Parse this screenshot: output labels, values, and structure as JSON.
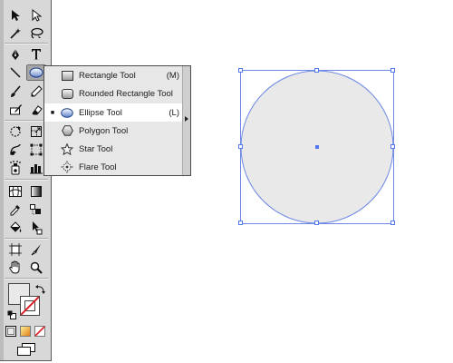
{
  "toolbar": {
    "tools": [
      {
        "name": "selection-tool",
        "icon": "black-arrow-icon"
      },
      {
        "name": "direct-selection-tool",
        "icon": "white-arrow-icon"
      },
      {
        "name": "magic-wand-tool",
        "icon": "magic-wand-icon"
      },
      {
        "name": "lasso-tool",
        "icon": "lasso-icon"
      },
      {
        "name": "pen-tool",
        "icon": "pen-icon"
      },
      {
        "name": "type-tool",
        "icon": "type-icon"
      },
      {
        "name": "line-segment-tool",
        "icon": "line-icon"
      },
      {
        "name": "ellipse-tool",
        "icon": "ellipse-icon",
        "active": true
      },
      {
        "name": "paintbrush-tool",
        "icon": "brush-icon"
      },
      {
        "name": "pencil-tool",
        "icon": "pencil-icon"
      },
      {
        "name": "blob-brush-tool",
        "icon": "blob-brush-icon"
      },
      {
        "name": "eraser-tool",
        "icon": "eraser-icon"
      },
      {
        "name": "rotate-tool",
        "icon": "rotate-icon"
      },
      {
        "name": "scale-tool",
        "icon": "scale-icon"
      },
      {
        "name": "warp-tool",
        "icon": "warp-icon"
      },
      {
        "name": "free-transform-tool",
        "icon": "free-transform-icon"
      },
      {
        "name": "symbol-sprayer-tool",
        "icon": "symbol-sprayer-icon"
      },
      {
        "name": "column-graph-tool",
        "icon": "column-graph-icon"
      },
      {
        "name": "mesh-tool",
        "icon": "mesh-icon"
      },
      {
        "name": "gradient-tool",
        "icon": "gradient-icon"
      },
      {
        "name": "eyedropper-tool",
        "icon": "eyedropper-icon"
      },
      {
        "name": "blend-tool",
        "icon": "blend-icon"
      },
      {
        "name": "live-paint-bucket-tool",
        "icon": "paint-bucket-icon"
      },
      {
        "name": "live-paint-selection-tool",
        "icon": "live-paint-selection-icon"
      },
      {
        "name": "artboard-tool",
        "icon": "artboard-icon"
      },
      {
        "name": "slice-tool",
        "icon": "slice-icon"
      },
      {
        "name": "hand-tool",
        "icon": "hand-icon"
      },
      {
        "name": "zoom-tool",
        "icon": "zoom-icon"
      }
    ],
    "fill_color": "#e9e9ea",
    "stroke_color": "none",
    "accent_red": "#dd1f26"
  },
  "flyout": {
    "items": [
      {
        "label": "Rectangle Tool",
        "shortcut": "(M)",
        "icon": "rectangle-icon",
        "selected": false
      },
      {
        "label": "Rounded Rectangle Tool",
        "shortcut": "",
        "icon": "rounded-rectangle-icon",
        "selected": false
      },
      {
        "label": "Ellipse Tool",
        "shortcut": "(L)",
        "icon": "ellipse-icon",
        "selected": true,
        "check": "■"
      },
      {
        "label": "Polygon Tool",
        "shortcut": "",
        "icon": "polygon-icon",
        "selected": false
      },
      {
        "label": "Star Tool",
        "shortcut": "",
        "icon": "star-icon",
        "selected": false
      },
      {
        "label": "Flare Tool",
        "shortcut": "",
        "icon": "flare-icon",
        "selected": false
      }
    ]
  },
  "canvas": {
    "object": {
      "shape": "ellipse",
      "fill": "#e9e9ea",
      "stroke": "#6f8ae6",
      "selected": true
    }
  }
}
